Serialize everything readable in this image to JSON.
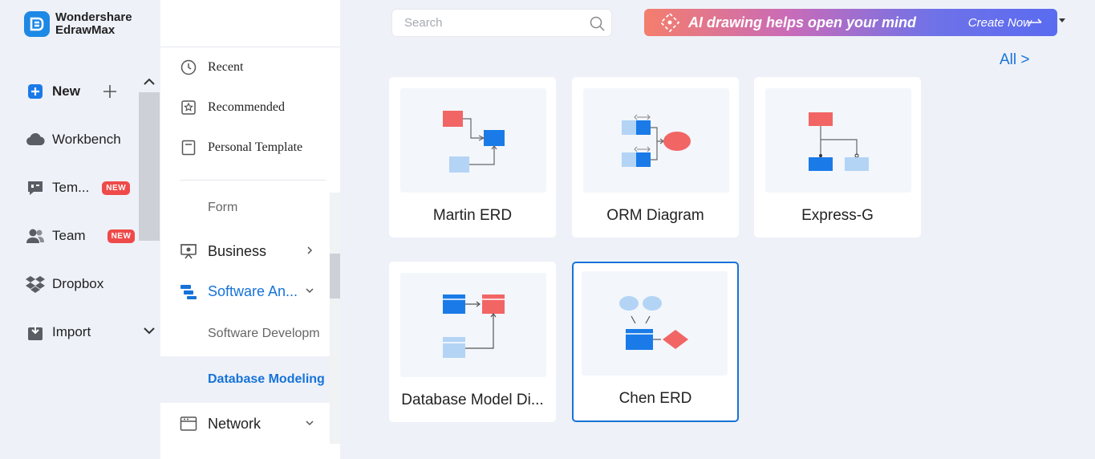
{
  "brand": {
    "line1": "Wondershare",
    "line2": "EdrawMax"
  },
  "nav": {
    "new_label": "New",
    "workbench_label": "Workbench",
    "templates_label": "Tem...",
    "templates_badge": "NEW",
    "team_label": "Team",
    "team_badge": "NEW",
    "dropbox_label": "Dropbox",
    "import_label": "Import"
  },
  "categories": {
    "recent": "Recent",
    "recommended": "Recommended",
    "personal_template": "Personal Template",
    "form": "Form",
    "business": "Business",
    "software": "Software An...",
    "software_dev": "Software Developm",
    "database_modeling": "Database Modeling",
    "network": "Network"
  },
  "search": {
    "placeholder": "Search"
  },
  "banner": {
    "text": "AI drawing helps open your mind",
    "cta": "Create Now"
  },
  "all_link": "All >",
  "cards": [
    {
      "label": "Martin ERD"
    },
    {
      "label": "ORM Diagram"
    },
    {
      "label": "Express-G"
    },
    {
      "label": "Database Model Di..."
    },
    {
      "label": "Chen ERD"
    }
  ],
  "colors": {
    "accent": "#1673d8",
    "badge": "#ef4a4a",
    "entity_red": "#f26565",
    "entity_blue": "#1a7be8",
    "entity_light": "#b3d4f5"
  }
}
